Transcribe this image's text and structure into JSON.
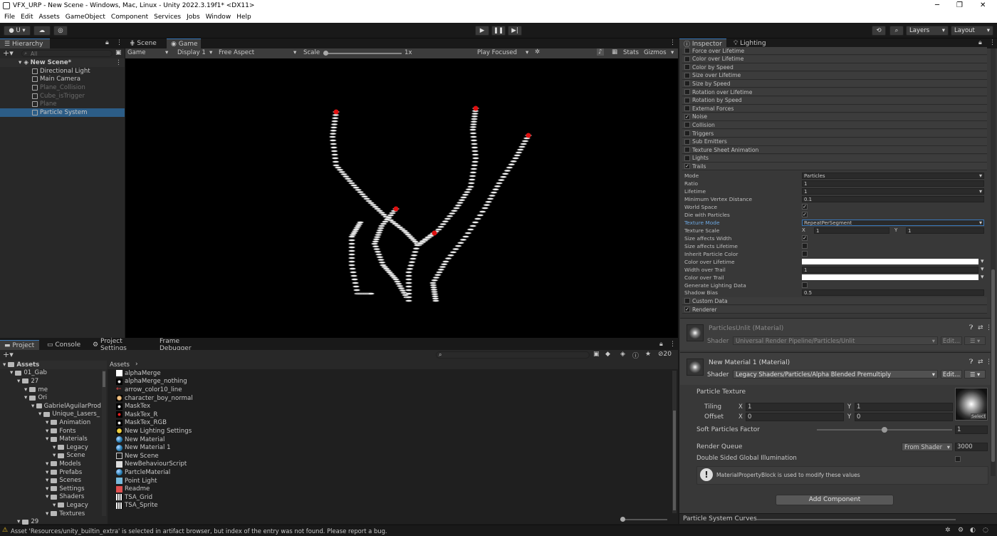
{
  "window": {
    "title": "VFX_URP - New Scene - Windows, Mac, Linux - Unity 2022.3.19f1* <DX11>"
  },
  "menu": [
    "File",
    "Edit",
    "Assets",
    "GameObject",
    "Component",
    "Services",
    "Jobs",
    "Window",
    "Help"
  ],
  "toolbar": {
    "account": "U",
    "layers": "Layers",
    "layout": "Layout"
  },
  "hierarchy": {
    "tab": "Hierarchy",
    "search_placeholder": "All",
    "scene": "New Scene*",
    "items": [
      {
        "label": "Directional Light",
        "disabled": false
      },
      {
        "label": "Main Camera",
        "disabled": false
      },
      {
        "label": "Plane_Collision",
        "disabled": true
      },
      {
        "label": "Cube_isTrigger",
        "disabled": true
      },
      {
        "label": "Plane",
        "disabled": true
      },
      {
        "label": "Particle System",
        "disabled": false,
        "selected": true
      }
    ]
  },
  "game": {
    "tabs": [
      "Scene",
      "Game"
    ],
    "mode": "Game",
    "display": "Display 1",
    "aspect": "Free Aspect",
    "scale_label": "Scale",
    "scale_value": "1x",
    "play_focused": "Play Focused",
    "stats": "Stats",
    "gizmos": "Gizmos"
  },
  "inspector": {
    "tabs": [
      "Inspector",
      "Lighting"
    ],
    "modules": [
      {
        "label": "Force over Lifetime",
        "checked": false
      },
      {
        "label": "Color over Lifetime",
        "checked": false
      },
      {
        "label": "Color by Speed",
        "checked": false
      },
      {
        "label": "Size over Lifetime",
        "checked": false
      },
      {
        "label": "Size by Speed",
        "checked": false
      },
      {
        "label": "Rotation over Lifetime",
        "checked": false
      },
      {
        "label": "Rotation by Speed",
        "checked": false
      },
      {
        "label": "External Forces",
        "checked": false
      },
      {
        "label": "Noise",
        "checked": true
      },
      {
        "label": "Collision",
        "checked": false
      },
      {
        "label": "Triggers",
        "checked": false
      },
      {
        "label": "Sub Emitters",
        "checked": false
      },
      {
        "label": "Texture Sheet Animation",
        "checked": false
      },
      {
        "label": "Lights",
        "checked": false
      },
      {
        "label": "Trails",
        "checked": true
      }
    ],
    "trails": {
      "mode_label": "Mode",
      "mode": "Particles",
      "ratio_label": "Ratio",
      "ratio": "1",
      "lifetime_label": "Lifetime",
      "lifetime": "1",
      "min_vertex_label": "Minimum Vertex Distance",
      "min_vertex": "0.1",
      "world_space_label": "World Space",
      "die_label": "Die with Particles",
      "texture_mode_label": "Texture Mode",
      "texture_mode": "RepeatPerSegment",
      "texture_scale_label": "Texture Scale",
      "tx_x": "X",
      "tx_xv": "1",
      "tx_y": "Y",
      "tx_yv": "1",
      "size_width_label": "Size affects Width",
      "size_lifetime_label": "Size affects Lifetime",
      "inherit_label": "Inherit Particle Color",
      "color_lifetime_label": "Color over Lifetime",
      "width_trail_label": "Width over Trail",
      "width_trail": "1",
      "color_trail_label": "Color over Trail",
      "gen_light_label": "Generate Lighting Data",
      "shadow_bias_label": "Shadow Bias",
      "shadow_bias": "0.5"
    },
    "custom_data": "Custom Data",
    "renderer": "Renderer",
    "mat1": {
      "name": "ParticlesUnlit (Material)",
      "shader_label": "Shader",
      "shader": "Universal Render Pipeline/Particles/Unlit",
      "edit": "Edit..."
    },
    "mat2": {
      "name": "New Material 1 (Material)",
      "shader_label": "Shader",
      "shader": "Legacy Shaders/Particles/Alpha Blended Premultiply",
      "edit": "Edit..."
    },
    "particle_texture": "Particle Texture",
    "tiling": "Tiling",
    "offset": "Offset",
    "tiling_x": "1",
    "tiling_y": "1",
    "offset_x": "0",
    "offset_y": "0",
    "x": "X",
    "y": "Y",
    "select": "Select",
    "soft_label": "Soft Particles Factor",
    "soft_value": "1",
    "soft_fraction": 0.5,
    "rq_label": "Render Queue",
    "rq_mode": "From Shader",
    "rq_value": "3000",
    "dsgi": "Double Sided Global Illumination",
    "info": "MaterialPropertyBlock is used to modify these values",
    "add_component": "Add Component",
    "curves": "Particle System Curves"
  },
  "project": {
    "tabs": [
      "Project",
      "Console",
      "Project Settings",
      "Frame Debugger"
    ],
    "breadcrumb": "Assets",
    "tree_root": "Assets",
    "tree": [
      {
        "label": "01_Gab",
        "depth": 1
      },
      {
        "label": "27",
        "depth": 2
      },
      {
        "label": "me",
        "depth": 3
      },
      {
        "label": "Ori",
        "depth": 3
      },
      {
        "label": "GabrielAguilarProd",
        "depth": 4
      },
      {
        "label": "Unique_Lasers_",
        "depth": 5
      },
      {
        "label": "Animation",
        "depth": 6
      },
      {
        "label": "Fonts",
        "depth": 6
      },
      {
        "label": "Materials",
        "depth": 6
      },
      {
        "label": "Legacy",
        "depth": 7
      },
      {
        "label": "Scene",
        "depth": 7
      },
      {
        "label": "Models",
        "depth": 6
      },
      {
        "label": "Prefabs",
        "depth": 6
      },
      {
        "label": "Scenes",
        "depth": 6
      },
      {
        "label": "Settings",
        "depth": 6
      },
      {
        "label": "Shaders",
        "depth": 6
      },
      {
        "label": "Legacy",
        "depth": 7
      },
      {
        "label": "Textures",
        "depth": 6
      },
      {
        "label": "29",
        "depth": 2
      }
    ],
    "assets": [
      {
        "label": "alphaMerge",
        "icon": "white"
      },
      {
        "label": "alphaMerge_nothing",
        "icon": "dot"
      },
      {
        "label": "arrow_color10_line",
        "icon": "arrow"
      },
      {
        "label": "character_boy_normal",
        "icon": "char"
      },
      {
        "label": "MaskTex",
        "icon": "dot"
      },
      {
        "label": "MaskTex_R",
        "icon": "reddot"
      },
      {
        "label": "MaskTex_RGB",
        "icon": "dot"
      },
      {
        "label": "New Lighting Settings",
        "icon": "light"
      },
      {
        "label": "New Material",
        "icon": "mat"
      },
      {
        "label": "New Material 1",
        "icon": "mat"
      },
      {
        "label": "New Scene",
        "icon": "unity"
      },
      {
        "label": "NewBehaviourScript",
        "icon": "script"
      },
      {
        "label": "PartcleMaterial",
        "icon": "mat"
      },
      {
        "label": "Point Light",
        "icon": "cube"
      },
      {
        "label": "Readme",
        "icon": "readme"
      },
      {
        "label": "TSA_Grid",
        "icon": "grid"
      },
      {
        "label": "TSA_Sprite",
        "icon": "grid"
      }
    ],
    "hidden_count": "20"
  },
  "status": {
    "message": "Asset 'Resources/unity_builtin_extra' is selected in artifact browser, but index of the entry was not found. Please report a bug."
  },
  "colors": {
    "accent": "#2c5d87",
    "bg": "#282828",
    "dark": "#191919",
    "particle_red": "#e01010"
  }
}
